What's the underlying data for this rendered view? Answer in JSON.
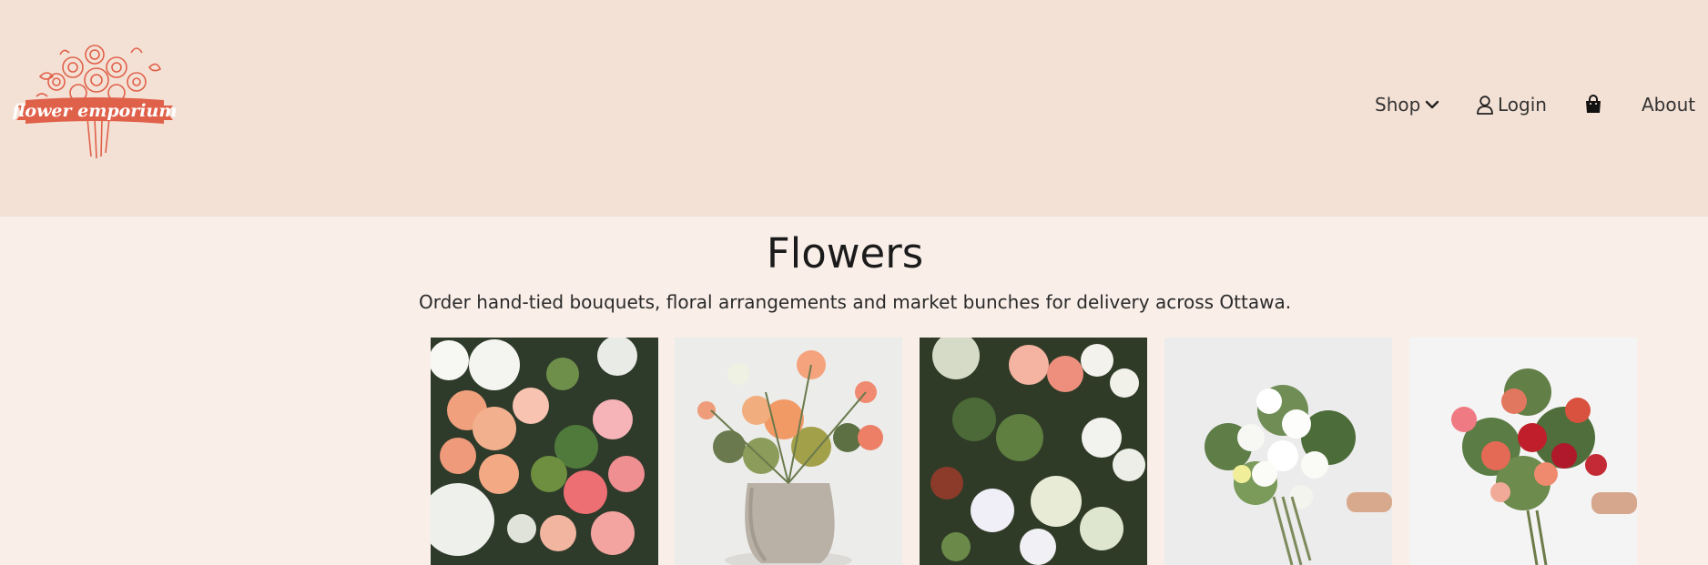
{
  "header": {
    "logo_text": "flower emporium",
    "nav": {
      "shop_label": "Shop",
      "login_label": "Login",
      "about_label": "About"
    }
  },
  "main": {
    "title": "Flowers",
    "subtitle": "Order hand-tied bouquets, floral arrangements and market bunches for delivery across Ottawa.",
    "products": [
      {
        "image": "pink-orange-roses-ranunculus-bunch"
      },
      {
        "image": "peach-ranunculus-in-stone-vase"
      },
      {
        "image": "white-green-mixed-flowers-bunch"
      },
      {
        "image": "white-roses-hand-tied-bouquet"
      },
      {
        "image": "red-coral-lily-bouquet"
      }
    ]
  },
  "colors": {
    "header_bg": "#f4e1d5",
    "page_bg": "#f9eee8",
    "logo": "#e0614a"
  }
}
